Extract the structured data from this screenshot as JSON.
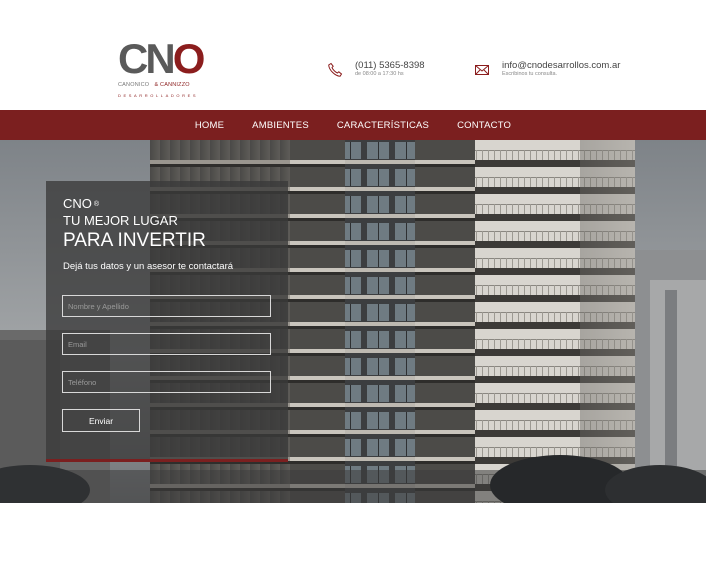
{
  "brand": {
    "logo_mark_c": "C",
    "logo_mark_n": "N",
    "logo_mark_o": "O",
    "logo_name_left": "CANONICO",
    "logo_name_amp": "& CANNIZZO",
    "logo_tagline": "DESARROLLADORES"
  },
  "contact": {
    "phone": "(011) 5365-8398",
    "phone_hours": "de 08:00 a 17:30 hs",
    "email": "info@cnodesarrollos.com.ar",
    "email_note": "Escribinos tu consulta."
  },
  "nav": {
    "items": [
      "HOME",
      "AMBIENTES",
      "CARACTERÍSTICAS",
      "CONTACTO"
    ]
  },
  "form": {
    "brand": "CNO",
    "registered": "®",
    "headline_1": "TU MEJOR LUGAR",
    "headline_2": "PARA INVERTIR",
    "description": "Dejá tus datos y un asesor te contactará",
    "name_placeholder": "Nombre y Apellido",
    "email_placeholder": "Email",
    "phone_placeholder": "Teléfono",
    "submit_label": "Enviar"
  },
  "colors": {
    "accent": "#7b1f1f",
    "logo_gray": "#5a5a5a",
    "panel": "#3a3a3a"
  },
  "icons": {
    "phone": "phone-icon",
    "mail": "mail-icon"
  }
}
